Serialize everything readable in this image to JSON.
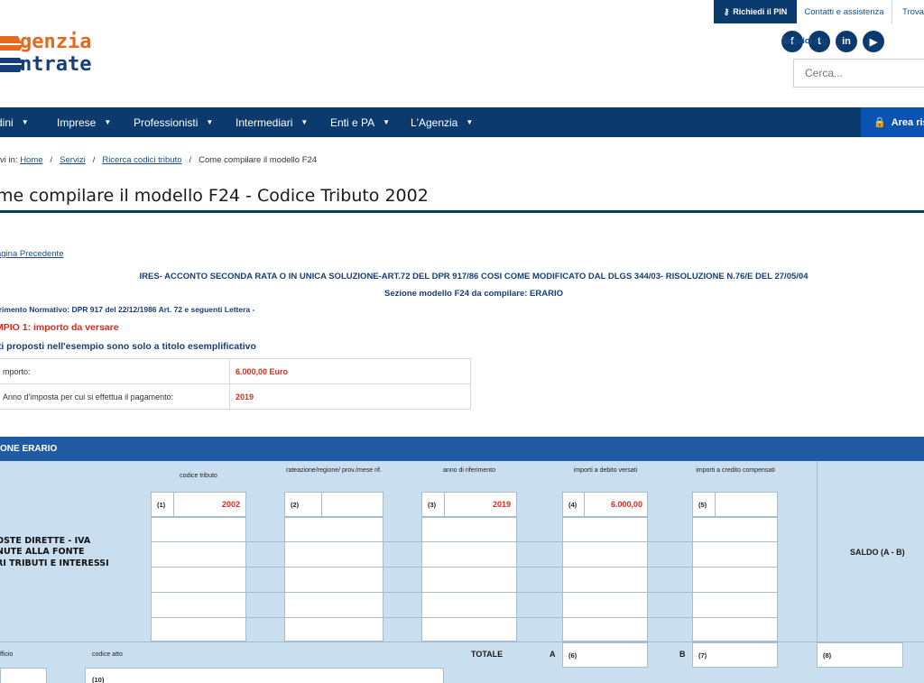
{
  "util": {
    "pin_label": "Richiedi il PIN",
    "contatti": "Contatti e assistenza",
    "trova": "Trova"
  },
  "logo": {
    "line1": "genzia",
    "line2": "ntrate"
  },
  "social": {
    "label": "Seguici su:",
    "icons": [
      "facebook-icon",
      "twitter-icon",
      "linkedin-icon",
      "youtube-icon"
    ]
  },
  "search": {
    "placeholder": "Cerca..."
  },
  "nav": {
    "items": [
      "dini",
      "Imprese",
      "Professionisti",
      "Intermediari",
      "Enti e PA",
      "L'Agenzia"
    ],
    "area": "Area ris"
  },
  "breadcrumb": {
    "prefix": "vi in:",
    "home": "Home",
    "servizi": "Servizi",
    "ricerca": "Ricerca codici tributo",
    "current": "Come compilare il modello F24"
  },
  "page": {
    "title": "me compilare il modello F24 - Codice Tributo 2002",
    "prev": "agina Precedente",
    "ires": "IRES- ACCONTO SECONDA RATA O IN UNICA SOLUZIONE-ART.72 DEL DPR 917/86 COSI COME MODIFICATO DAL DLGS 344/03- RISOLUZIONE N.76/E DEL 27/05/04",
    "sezione": "Sezione modello F24 da compilare: ERARIO",
    "riferimento": "erimento Normativo: DPR  917 del 22/12/1986 Art. 72 e seguenti Lettera -",
    "esempio": "EMPIO 1: importo da versare",
    "dati": "ati proposti nell'esempio sono solo a titolo esemplificativo"
  },
  "info": {
    "rows": [
      {
        "k": "mporto:",
        "v": "6.000,00 Euro"
      },
      {
        "k": "Anno d'imposta per cui si effettua il pagamento:",
        "v": "2019"
      }
    ]
  },
  "f24": {
    "header": "ONE ERARIO",
    "col_codice": "codice tributo",
    "col_rateazione": "rateazione/regione/ prov./mese rif.",
    "col_anno": "anno di riferimento",
    "col_debito": "importi a debito versati",
    "col_credito": "importi a credito compensati",
    "imposte": [
      "OSTE DIRETTE - IVA",
      "NUTE ALLA FONTE",
      "RI TRIBUTI E INTERESSI"
    ],
    "n1": "(1)",
    "codice_val": "2002",
    "n2": "(2)",
    "n3": "(3)",
    "anno_val": "2019",
    "n4": "(4)",
    "debito_val": "6.000,00",
    "n5": "(5)",
    "saldo": "SALDO (A - B)",
    "ufficio": "fficio",
    "codice_atto": "codice atto",
    "totale": "TOTALE",
    "a": "A",
    "n6": "(6)",
    "b": "B",
    "n7": "(7)",
    "n8": "(8)",
    "n10": "(10)"
  }
}
